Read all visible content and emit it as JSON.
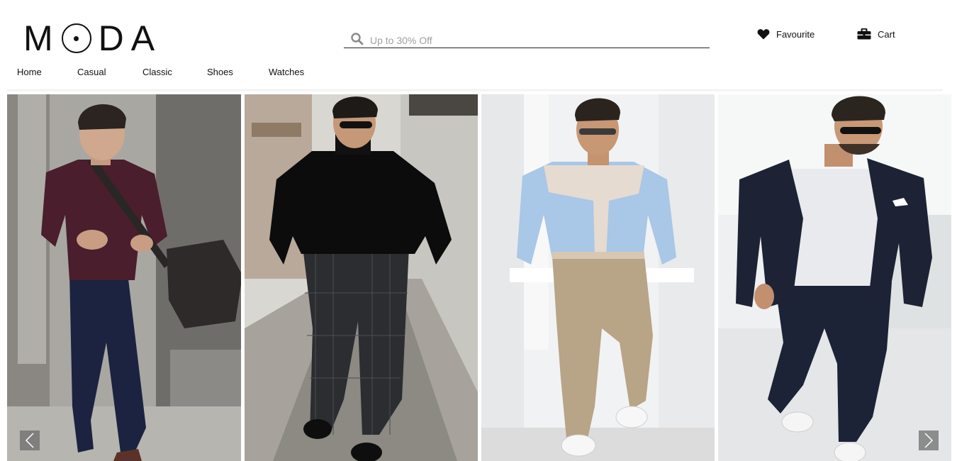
{
  "brand": {
    "logo_text": [
      "M",
      "D",
      "A"
    ]
  },
  "nav": {
    "items": [
      {
        "label": "Home"
      },
      {
        "label": "Casual"
      },
      {
        "label": "Classic"
      },
      {
        "label": "Shoes"
      },
      {
        "label": "Watches"
      }
    ]
  },
  "search": {
    "placeholder": "Up to 30% Off",
    "icon": "search-icon"
  },
  "header_actions": {
    "favourite": {
      "label": "Favourite",
      "icon": "heart-icon"
    },
    "cart": {
      "label": "Cart",
      "icon": "briefcase-icon"
    }
  },
  "carousel": {
    "slide_count": 4,
    "prev_icon": "chevron-left-icon",
    "next_icon": "chevron-right-icon"
  }
}
